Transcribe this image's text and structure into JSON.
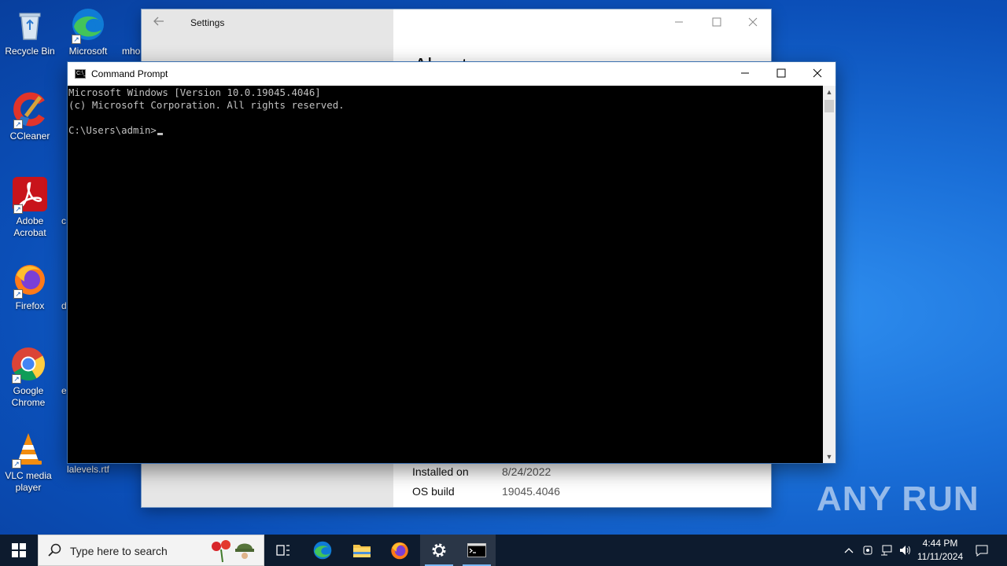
{
  "desktop": {
    "icons": [
      {
        "label": "Recycle Bin"
      },
      {
        "label": "Microsoft Edge"
      },
      {
        "label": "CCleaner"
      },
      {
        "label": "Adobe Acrobat"
      },
      {
        "label": "Firefox"
      },
      {
        "label": "Google Chrome"
      },
      {
        "label": "VLC media player"
      },
      {
        "label": "lalevels.rtf"
      }
    ],
    "partial_labels": [
      "mho",
      "c",
      "d",
      "e"
    ]
  },
  "settings": {
    "title": "Settings",
    "heading": "About",
    "specs": [
      {
        "label": "Installed on",
        "value": "8/24/2022"
      },
      {
        "label": "OS build",
        "value": "19045.4046"
      }
    ]
  },
  "cmd": {
    "title": "Command Prompt",
    "icon_text": "C:\\_",
    "lines": [
      "Microsoft Windows [Version 10.0.19045.4046]",
      "(c) Microsoft Corporation. All rights reserved.",
      ""
    ],
    "prompt": "C:\\Users\\admin>"
  },
  "watermark": "ANY RUN",
  "taskbar": {
    "search_placeholder": "Type here to search",
    "time": "4:44 PM",
    "date": "11/11/2024"
  },
  "colors": {
    "desktop": "#1a6fd8",
    "taskbar": "#0d1b2e",
    "console_bg": "#000000",
    "console_fg": "#c0c0c0"
  }
}
